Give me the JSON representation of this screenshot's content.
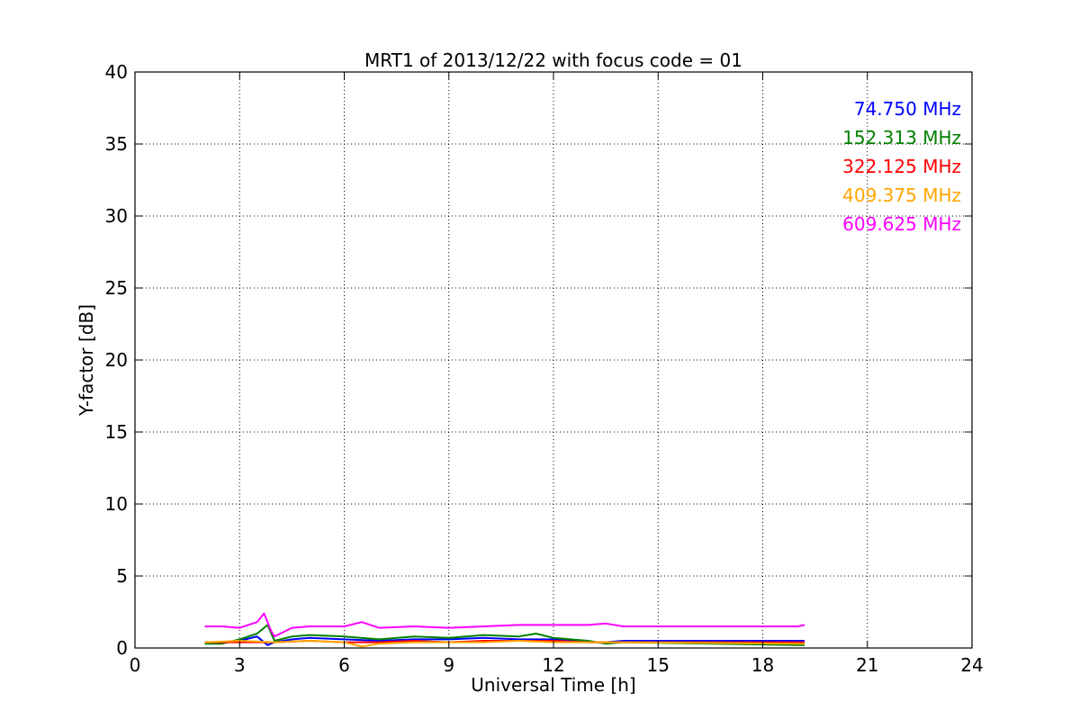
{
  "chart_data": {
    "type": "line",
    "title": "MRT1 of 2013/12/22 with focus code = 01",
    "xlabel": "Universal Time [h]",
    "ylabel": "Y-factor [dB]",
    "xlim": [
      0,
      24
    ],
    "ylim": [
      0,
      40
    ],
    "xticks": [
      0,
      3,
      6,
      9,
      12,
      15,
      18,
      21,
      24
    ],
    "yticks": [
      0,
      5,
      10,
      15,
      20,
      25,
      30,
      35,
      40
    ],
    "grid": true,
    "legend_position": "top-right",
    "series": [
      {
        "name": "74.750 MHz",
        "color": "#0000ff",
        "x": [
          2.0,
          2.5,
          3.0,
          3.5,
          3.8,
          4.0,
          4.5,
          5.0,
          6.0,
          7.0,
          8.0,
          9.0,
          10.0,
          11.0,
          12.0,
          13.0,
          13.5,
          14.0,
          19.0,
          19.2
        ],
        "y": [
          0.4,
          0.4,
          0.5,
          0.8,
          0.2,
          0.4,
          0.6,
          0.7,
          0.6,
          0.5,
          0.6,
          0.6,
          0.7,
          0.6,
          0.6,
          0.4,
          0.4,
          0.5,
          0.5,
          0.5
        ]
      },
      {
        "name": "152.313 MHz",
        "color": "#008000",
        "x": [
          2.0,
          2.5,
          3.0,
          3.5,
          3.8,
          4.0,
          4.5,
          5.0,
          6.0,
          7.0,
          8.0,
          9.0,
          10.0,
          11.0,
          11.5,
          12.0,
          13.0,
          13.5,
          14.0,
          19.0,
          19.2
        ],
        "y": [
          0.3,
          0.3,
          0.6,
          1.0,
          1.6,
          0.5,
          0.8,
          0.9,
          0.8,
          0.6,
          0.8,
          0.7,
          0.9,
          0.8,
          1.0,
          0.7,
          0.5,
          0.3,
          0.4,
          0.2,
          0.2
        ]
      },
      {
        "name": "322.125 MHz",
        "color": "#ff0000",
        "x": [
          2.0,
          3.0,
          4.0,
          5.0,
          6.0,
          7.0,
          8.0,
          9.0,
          10.0,
          11.0,
          12.0,
          13.0,
          14.0,
          19.0,
          19.2
        ],
        "y": [
          0.4,
          0.4,
          0.4,
          0.5,
          0.4,
          0.4,
          0.5,
          0.4,
          0.5,
          0.5,
          0.5,
          0.4,
          0.4,
          0.4,
          0.4
        ]
      },
      {
        "name": "409.375 MHz",
        "color": "#ffa500",
        "x": [
          2.0,
          3.0,
          4.0,
          5.0,
          6.0,
          6.5,
          7.0,
          8.0,
          9.0,
          10.0,
          11.0,
          12.0,
          13.0,
          14.0,
          19.0,
          19.2
        ],
        "y": [
          0.4,
          0.5,
          0.4,
          0.5,
          0.4,
          0.1,
          0.3,
          0.4,
          0.4,
          0.4,
          0.5,
          0.4,
          0.4,
          0.4,
          0.3,
          0.3
        ]
      },
      {
        "name": "609.625 MHz",
        "color": "#ff00ff",
        "x": [
          2.0,
          2.5,
          3.0,
          3.5,
          3.7,
          3.9,
          4.0,
          4.5,
          5.0,
          6.0,
          6.5,
          7.0,
          8.0,
          9.0,
          10.0,
          11.0,
          12.0,
          13.0,
          13.5,
          14.0,
          19.0,
          19.2
        ],
        "y": [
          1.5,
          1.5,
          1.4,
          1.8,
          2.4,
          1.2,
          0.8,
          1.4,
          1.5,
          1.5,
          1.8,
          1.4,
          1.5,
          1.4,
          1.5,
          1.6,
          1.6,
          1.6,
          1.7,
          1.5,
          1.5,
          1.6
        ]
      }
    ]
  }
}
